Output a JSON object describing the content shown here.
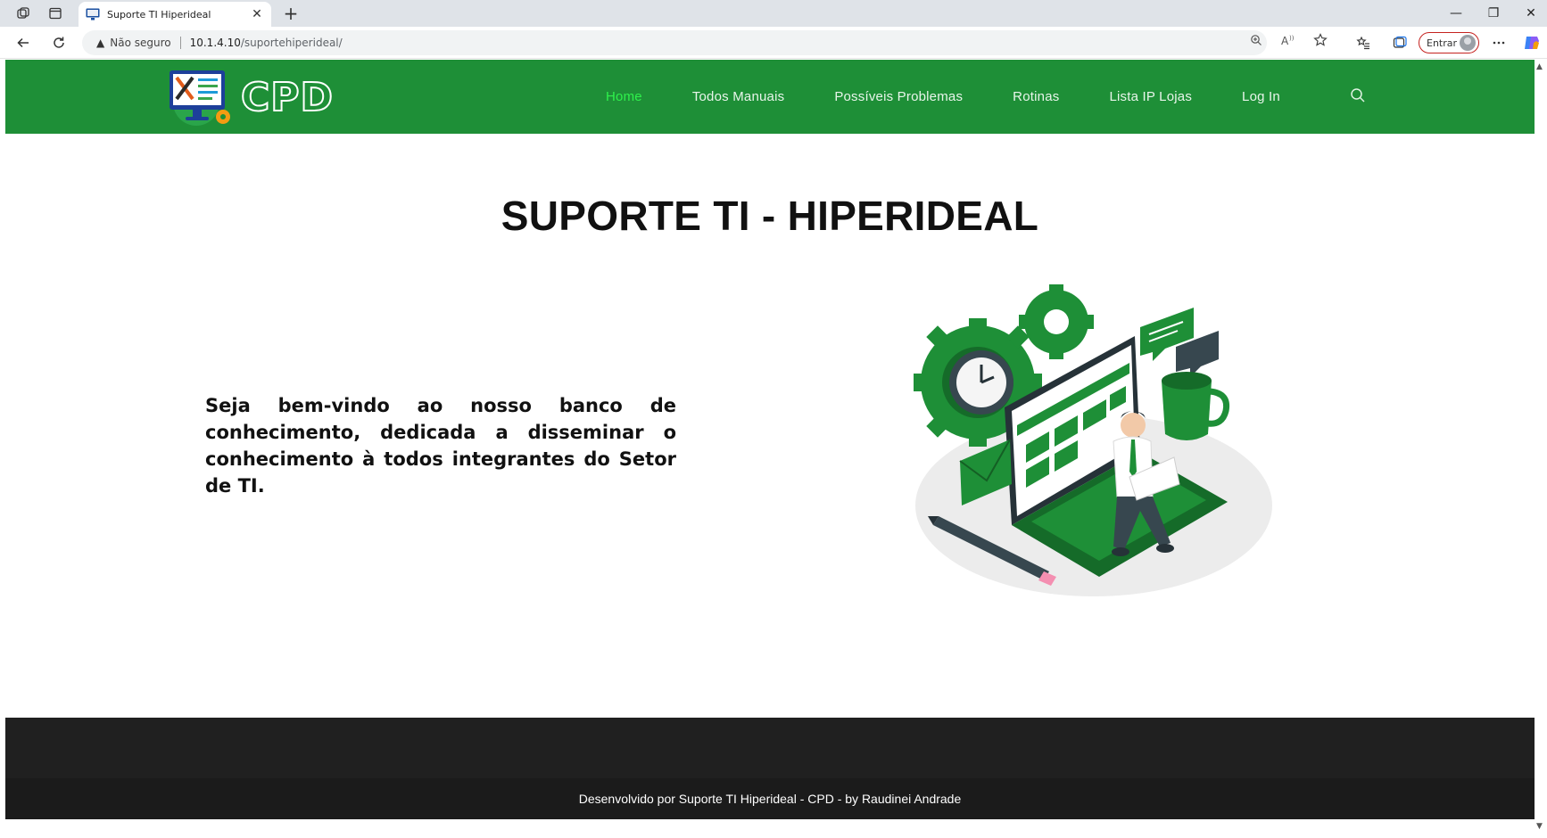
{
  "browser": {
    "tab": {
      "title": "Suporte TI Hiperideal",
      "close": "✕"
    },
    "new_tab": "+",
    "security_label": "Não seguro",
    "url": {
      "host": "10.1.4.10",
      "path": "/suportehiperideal/"
    },
    "profile_button": "Entrar",
    "window_controls": {
      "minimize": "—",
      "restore": "❐",
      "close": "✕"
    }
  },
  "site": {
    "logo_text": "CPD",
    "nav": [
      {
        "label": "Home",
        "active": true
      },
      {
        "label": "Todos Manuais",
        "active": false
      },
      {
        "label": "Possíveis Problemas",
        "active": false
      },
      {
        "label": "Rotinas",
        "active": false
      },
      {
        "label": "Lista IP Lojas",
        "active": false
      },
      {
        "label": "Log In",
        "active": false
      }
    ],
    "title": "SUPORTE TI - HIPERIDEAL",
    "intro": "Seja bem-vindo ao nosso banco de conhecimento, dedicada a disseminar o conhecimento à todos integrantes do Setor de TI.",
    "footer_text": "Desenvolvido por Suporte TI Hiperideal - CPD - by Raudinei Andrade"
  },
  "colors": {
    "header_green": "#1e8f37",
    "active_nav": "#2ff04c",
    "footer_dark": "#202020"
  }
}
